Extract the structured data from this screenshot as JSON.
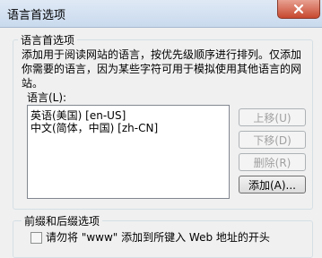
{
  "window": {
    "title": "语言首选项"
  },
  "preferences_group": {
    "legend": "语言首选项",
    "description": "添加用于阅读网站的语言，按优先级顺序进行排列。仅添加你需要的语言，因为某些字符可用于模拟使用其他语言的网站。",
    "languages_label": "语言(L):",
    "languages": [
      "英语(美国) [en-US]",
      "中文(简体，中国) [zh-CN]"
    ],
    "buttons": {
      "move_up": "上移(U)",
      "move_down": "下移(D)",
      "remove": "删除(R)",
      "add": "添加(A)..."
    }
  },
  "prefix_suffix_group": {
    "legend": "前缀和后缀选项",
    "checkbox_label": "请勿将 \"www\" 添加到所键入 Web 地址的开头"
  }
}
